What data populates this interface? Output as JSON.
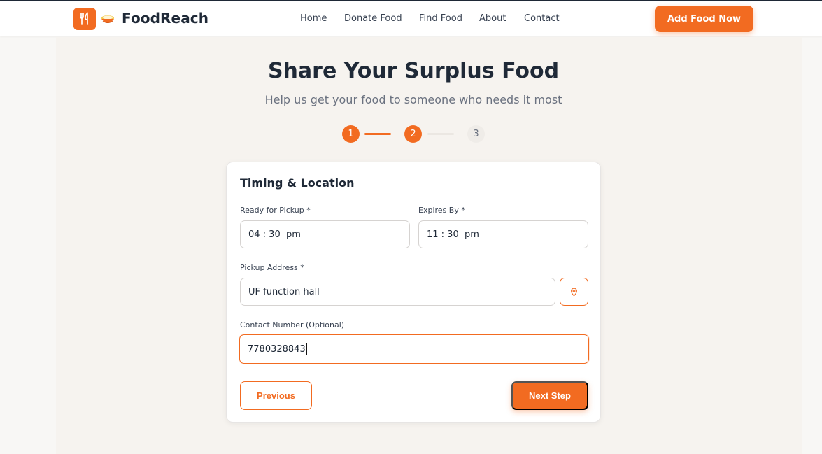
{
  "brand": {
    "name": "FoodReach",
    "accent": "#f26b21"
  },
  "nav": {
    "links": [
      "Home",
      "Donate Food",
      "Find Food",
      "About",
      "Contact"
    ],
    "cta_label": "Add Food Now"
  },
  "hero": {
    "title": "Share Your Surplus Food",
    "subtitle": "Help us get your food to someone who needs it most"
  },
  "stepper": {
    "steps": [
      "1",
      "2",
      "3"
    ],
    "current": 2
  },
  "form": {
    "section_title": "Timing & Location",
    "ready_label": "Ready for Pickup *",
    "ready_value": "04 : 30  pm",
    "expires_label": "Expires By *",
    "expires_value": "11 : 30  pm",
    "address_label": "Pickup Address *",
    "address_value": "UF function hall",
    "contact_label": "Contact Number (Optional)",
    "contact_value": "7780328843",
    "prev_label": "Previous",
    "next_label": "Next Step"
  },
  "icons": {
    "logo": "utensils-icon",
    "bowl": "bowl-emoji-icon",
    "location": "map-pin-icon"
  }
}
